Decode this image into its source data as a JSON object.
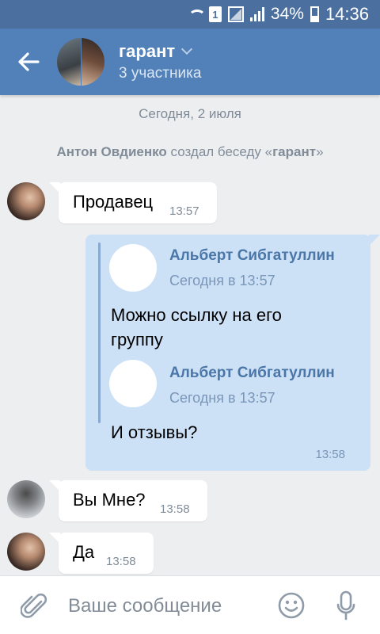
{
  "status_bar": {
    "sim_label": "1",
    "battery": "34%",
    "time": "14:36"
  },
  "header": {
    "title": "гарант",
    "subtitle": "3 участника"
  },
  "chat": {
    "date_separator": "Сегодня, 2 июля",
    "service": {
      "author": "Антон Овдиенко",
      "action": " создал беседу «",
      "chat_name": "гарант",
      "end": "»"
    },
    "messages": [
      {
        "text": "Продавец",
        "time": "13:57",
        "avatar": "girl"
      },
      {
        "outgoing": true,
        "forwarded": [
          {
            "name": "Альберт Сибгатуллин",
            "date": "Сегодня в 13:57",
            "text": "Можно ссылку на его группу"
          },
          {
            "name": "Альберт Сибгатуллин",
            "date": "Сегодня в 13:57",
            "text": "И отзывы?"
          }
        ],
        "time": "13:58"
      },
      {
        "text": "Вы Мне?",
        "time": "13:58",
        "avatar": "man"
      },
      {
        "text": "Да",
        "time": "13:58",
        "avatar": "girl"
      }
    ]
  },
  "composer": {
    "placeholder": "Ваше сообщение"
  },
  "colors": {
    "header": "#5181b8",
    "status_bar": "#4b6f9e",
    "outgoing_bubble": "#cce0f6",
    "link_name": "#4a76a8"
  },
  "icons": [
    "wifi-icon",
    "sim-icon",
    "signal-icon",
    "battery-icon",
    "back-arrow-icon",
    "chevron-down-icon",
    "attach-icon",
    "smile-icon",
    "mic-icon"
  ]
}
